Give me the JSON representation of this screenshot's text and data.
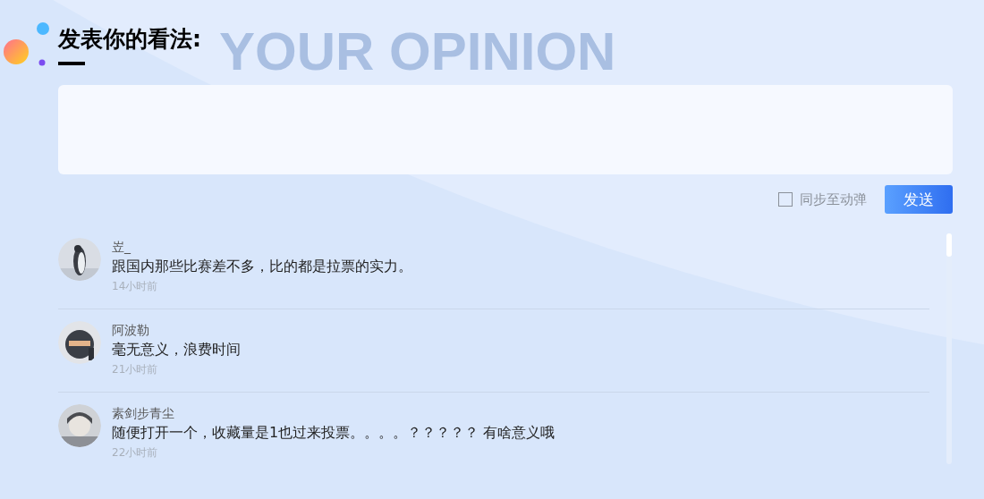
{
  "heading": {
    "title": "发表你的看法:",
    "backdrop": "YOUR OPINION"
  },
  "composer": {
    "sync_option": {
      "label": "同步至动弹",
      "checked": false
    },
    "send_button": "发送"
  },
  "comments": [
    {
      "author": "岦_",
      "text": "跟国内那些比赛差不多，比的都是拉票的实力。",
      "time": "14小时前"
    },
    {
      "author": "阿波勒",
      "text": "毫无意义，浪费时间",
      "time": "21小时前"
    },
    {
      "author": "素剑步青尘",
      "text": "随便打开一个，收藏量是1也过来投票。。。。？？？？？ 有啥意义哦",
      "time": "22小时前"
    }
  ]
}
